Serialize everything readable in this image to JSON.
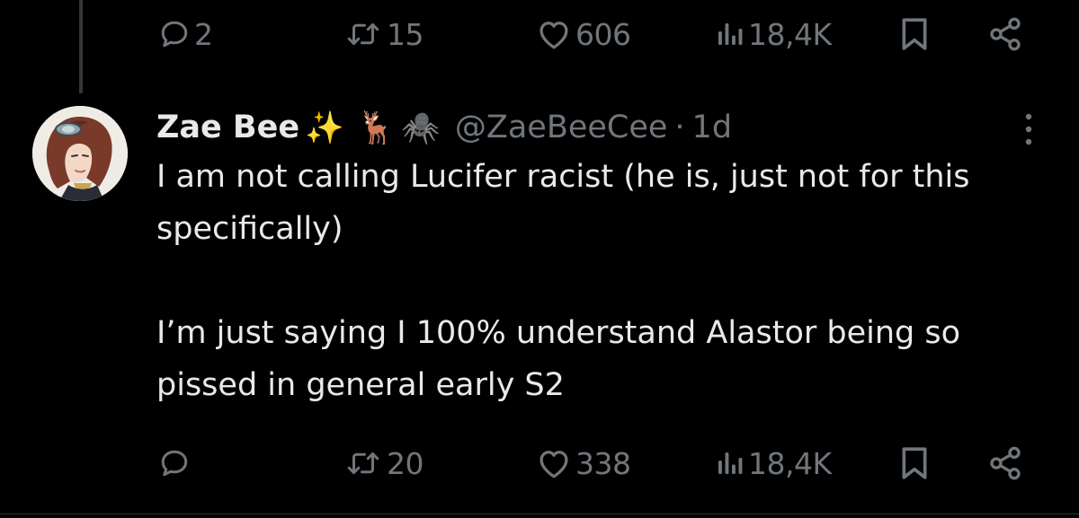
{
  "colors": {
    "background": "#000000",
    "text_primary": "#e7e9ea",
    "text_secondary": "#71767b",
    "thread_line": "#333639"
  },
  "parent_actions": {
    "reply_count": "2",
    "repost_count": "15",
    "like_count": "606",
    "view_count": "18,4K"
  },
  "tweet": {
    "display_name": "Zae Bee",
    "name_emojis": [
      "✨",
      "🦌",
      "🕷️"
    ],
    "handle": "@ZaeBeeCee",
    "separator": "·",
    "time": "1d",
    "text": "I am not calling Lucifer racist (he is, just not for this specifically)\n\nI’m just saying I 100% understand Alastor being so pissed in general early S2",
    "actions": {
      "reply_count": "",
      "repost_count": "20",
      "like_count": "338",
      "view_count": "18,4K"
    }
  },
  "icons": {
    "reply": "reply-icon",
    "repost": "repost-icon",
    "like": "heart-icon",
    "views": "views-icon",
    "bookmark": "bookmark-icon",
    "share": "share-icon",
    "more": "more-vertical-icon"
  }
}
